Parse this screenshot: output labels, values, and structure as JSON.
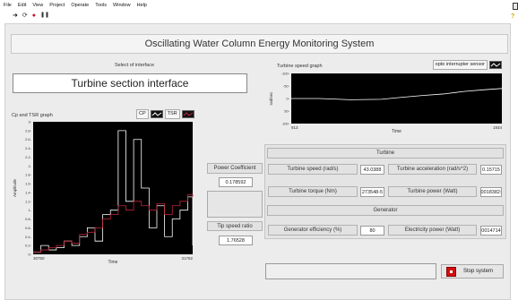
{
  "menu": [
    "File",
    "Edit",
    "View",
    "Project",
    "Operate",
    "Tools",
    "Window",
    "Help"
  ],
  "toolbar": {
    "run": "➜",
    "run_cont": "⟳",
    "abort": "●",
    "pause": "❚❚",
    "help": "?"
  },
  "title": "Oscillating Water Column Energy Monitoring System",
  "interface": {
    "caption": "Select of interface",
    "value": "Turbine section interface"
  },
  "cp_graph": {
    "title": "Cp and TSR graph",
    "legend": [
      "CP",
      "TSR"
    ]
  },
  "speed_graph": {
    "title": "Turbine speed graph",
    "legend": [
      "opto interrupter sensor"
    ]
  },
  "middle": {
    "pc_label": "Power Coefficient",
    "pc_value": "0.178592",
    "tsr_label": "Tip speed ratio",
    "tsr_value": "1.76528"
  },
  "turbine": {
    "heading": "Turbine",
    "speed_label": "Turbine speed (rad/s)",
    "speed_value": "43.0388",
    "accel_label": "Turbine acceleration (rad/s^2)",
    "accel_value": "0.15715",
    "torque_label": "Turbine torque (Nm)",
    "torque_value": "273548-5",
    "power_label": "Turbine power (Watt)",
    "power_value": "0018382:"
  },
  "generator": {
    "heading": "Generator",
    "eff_label": "Generator efficiency (%)",
    "eff_value": "80",
    "elec_label": "Electricity power (Watt)",
    "elec_value": "0014714"
  },
  "stop_label": "Stop system",
  "chart_data": [
    {
      "type": "line",
      "title": "",
      "xlabel": "Time",
      "ylabel": "Amplitude",
      "xlim": [
        30750,
        31782
      ],
      "ylim": [
        0,
        3
      ],
      "x_ticks": [
        "30750",
        "31782"
      ],
      "y_ticks": [
        "0-",
        "0.2-",
        "0.4-",
        "0.6-",
        "0.8-",
        "1-",
        "1.2-",
        "1.4-",
        "1.6-",
        "1.8-",
        "2-",
        "2.2-",
        "2.4-",
        "2.6-",
        "2.8-",
        "3-"
      ],
      "series": [
        {
          "name": "CP",
          "color": "#ffffff",
          "x": [
            30750,
            30800,
            30850,
            30900,
            30950,
            31000,
            31050,
            31100,
            31150,
            31200,
            31250,
            31300,
            31350,
            31400,
            31450,
            31500,
            31550,
            31600,
            31650,
            31700,
            31750,
            31782
          ],
          "y": [
            0.05,
            0.2,
            0.1,
            0.15,
            0.3,
            0.2,
            0.4,
            0.6,
            0.3,
            0.9,
            1.0,
            2.8,
            1.2,
            2.6,
            1.5,
            0.6,
            1.1,
            0.4,
            0.8,
            1.0,
            1.3,
            0.2
          ]
        },
        {
          "name": "TSR",
          "color": "#c0263a",
          "x": [
            30750,
            30800,
            30850,
            30900,
            30950,
            31000,
            31050,
            31100,
            31150,
            31200,
            31250,
            31300,
            31350,
            31400,
            31450,
            31500,
            31550,
            31600,
            31650,
            31700,
            31750,
            31782
          ],
          "y": [
            0.05,
            0.1,
            0.15,
            0.2,
            0.3,
            0.25,
            0.45,
            0.5,
            0.6,
            0.8,
            0.9,
            1.1,
            1.0,
            1.2,
            1.1,
            1.0,
            1.15,
            0.9,
            1.1,
            1.2,
            1.35,
            1.3
          ]
        }
      ]
    },
    {
      "type": "line",
      "title": "",
      "xlabel": "Time",
      "ylabel": "rad/sec",
      "xlim": [
        913,
        1934
      ],
      "ylim": [
        -100,
        100
      ],
      "x_ticks": [
        "913",
        "1934"
      ],
      "y_ticks": [
        "100-",
        "50-",
        "0-",
        "-50-",
        "-100-"
      ],
      "series": [
        {
          "name": "opto interrupter sensor",
          "color": "#ffffff",
          "x": [
            913,
            1050,
            1200,
            1350,
            1450,
            1550,
            1650,
            1750,
            1850,
            1934
          ],
          "y": [
            0,
            0,
            -5,
            -3,
            5,
            12,
            18,
            28,
            35,
            40
          ]
        }
      ]
    }
  ]
}
